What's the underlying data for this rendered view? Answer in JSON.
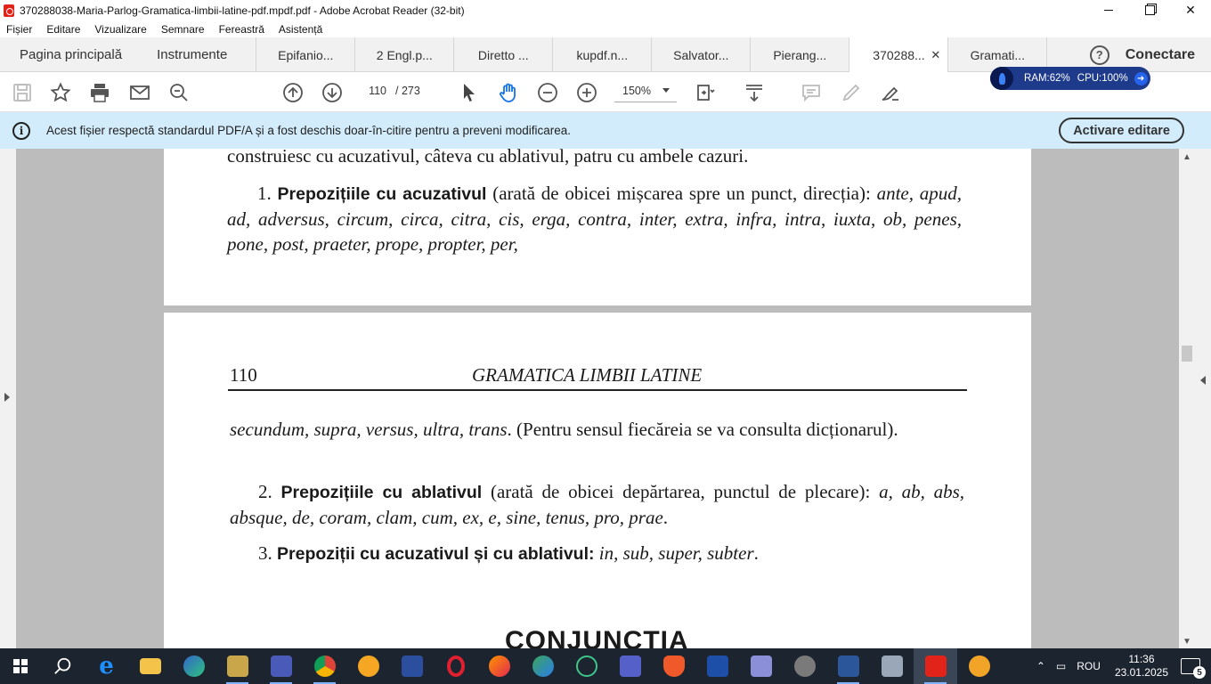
{
  "window": {
    "title": "370288038-Maria-Parlog-Gramatica-limbii-latine-pdf.mpdf.pdf - Adobe Acrobat Reader (32-bit)",
    "minimize": "",
    "restore": "",
    "close": "✕"
  },
  "menu": [
    "Fișier",
    "Editare",
    "Vizualizare",
    "Semnare",
    "Fereastră",
    "Asistență"
  ],
  "tabs": {
    "home": "Pagina principală",
    "tools": "Instrumente",
    "documents": [
      "Epifanio...",
      "2 Engl.p...",
      "Diretto ...",
      "kupdf.n...",
      "Salvator...",
      "Pierang...",
      "370288...",
      "Gramati..."
    ],
    "active_index": 6,
    "close_glyph": "✕",
    "help": "?",
    "signin": "Conectare"
  },
  "sysmon": {
    "ram": "RAM:62%",
    "cpu": "CPU:100%",
    "arrow": "➜"
  },
  "toolbar": {
    "page_current": "110",
    "page_total": "/  273",
    "zoom": "150%"
  },
  "infobar": {
    "icon": "i",
    "message": "Acest fișier respectă standardul PDF/A și a fost deschis doar-în-citire pentru a preveni modificarea.",
    "button": "Activare editare"
  },
  "document": {
    "page1": {
      "line0": "construiesc cu acuzativul, câteva cu ablativul, patru cu ambele cazuri.",
      "p1_num": "1. ",
      "p1_bold": "Prepozițiile cu acuzativul",
      "p1_text": " (arată de obicei mișcarea spre un punct, direcția): ",
      "p1_italic": "ante, apud, ad, adversus, circum, circa, citra, cis, erga, contra, inter, extra, infra, intra, iuxta, ob, penes, pone, post, praeter, prope, propter, per,"
    },
    "page2": {
      "page_number": "110",
      "running_head": "GRAMATICA LIMBII LATINE",
      "p0_italic": "secundum, supra, versus, ultra, trans",
      "p0_text": ". (Pentru sensul fiecăreia se va consulta dicționarul).",
      "p2_num": "2. ",
      "p2_bold": "Prepozițiile cu ablativul",
      "p2_text": " (arată de obicei depărtarea, punctul de plecare): ",
      "p2_italic": "a, ab, abs, absque, de, coram, clam, cum, ex, e, sine, tenus, pro, prae",
      "p2_end": ".",
      "p3_num": "3. ",
      "p3_bold": "Prepoziții cu acuzativul și cu ablativul:",
      "p3_italic": " in, sub, super, subter",
      "p3_end": ".",
      "chapter": "CONJUNCȚIA"
    }
  },
  "taskbar": {
    "language": "ROU",
    "time": "11:36",
    "date": "23.01.2025",
    "notifications": "5"
  },
  "colors": {
    "infobar_bg": "#d2ecfb",
    "sysmon_bg": "#1e3a8a",
    "taskbar_bg": "#1c2430",
    "acrobat_red": "#e2231a"
  }
}
